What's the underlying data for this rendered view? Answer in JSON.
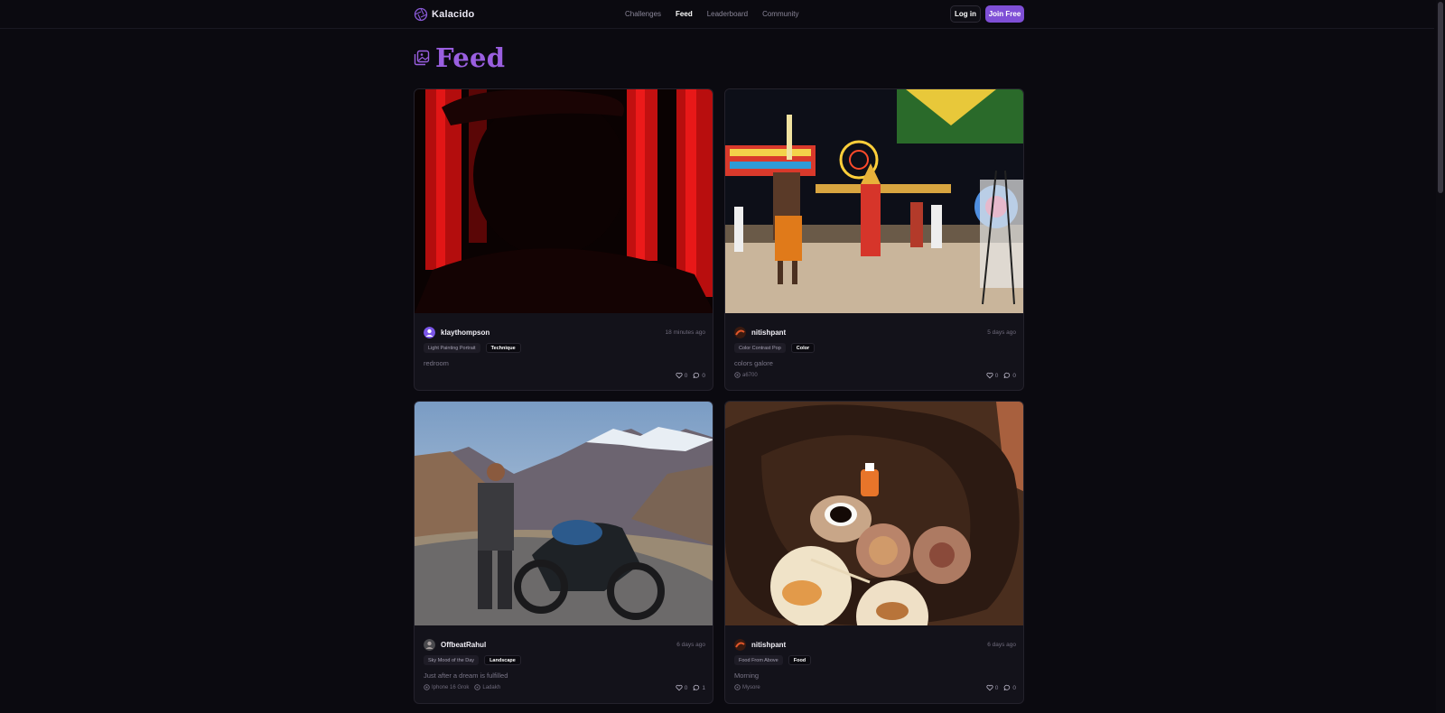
{
  "nav": {
    "brand": "Kalacido",
    "links": [
      "Challenges",
      "Feed",
      "Leaderboard",
      "Community"
    ],
    "active_link": "Feed",
    "login_label": "Log in",
    "join_label": "Join Free"
  },
  "page": {
    "title": "Feed"
  },
  "posts": [
    {
      "username": "klaythompson",
      "time": "18 minutes ago",
      "challenge_tag": "Light Painting Portrait",
      "category_tag": "Technique",
      "caption": "redroom",
      "camera": "",
      "location": "",
      "likes": "0",
      "comments": "0"
    },
    {
      "username": "nitishpant",
      "time": "5 days ago",
      "challenge_tag": "Color Contrast Pop",
      "category_tag": "Color",
      "caption": "colors galore",
      "camera": "a6700",
      "location": "",
      "likes": "0",
      "comments": "0"
    },
    {
      "username": "OffbeatRahul",
      "time": "6 days ago",
      "challenge_tag": "Sky Mood of the Day",
      "category_tag": "Landscape",
      "caption": "Just after a dream is fulfilled",
      "camera": "Iphone 16 Grok",
      "location": "Ladakh",
      "likes": "0",
      "comments": "1"
    },
    {
      "username": "nitishpant",
      "time": "6 days ago",
      "challenge_tag": "Food From Above",
      "category_tag": "Food",
      "caption": "Morning",
      "camera": "",
      "location": "Mysore",
      "likes": "0",
      "comments": "0"
    }
  ],
  "colors": {
    "accent": "#7f4fd6",
    "title": "#9a5fe0",
    "background": "#0b0a10",
    "card": "#13121a"
  }
}
